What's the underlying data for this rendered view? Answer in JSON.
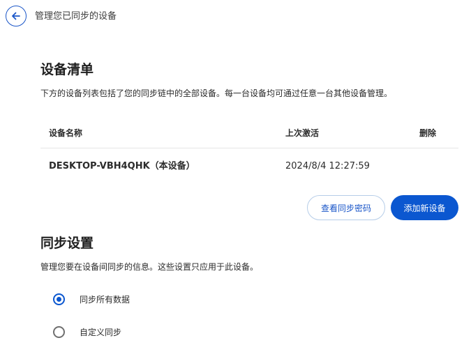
{
  "header": {
    "title": "管理您已同步的设备"
  },
  "devices_section": {
    "title": "设备清单",
    "description": "下方的设备列表包括了您的同步链中的全部设备。每一台设备均可通过任意一台其他设备管理。",
    "table": {
      "columns": [
        "设备名称",
        "上次激活",
        "删除"
      ],
      "rows": [
        {
          "name": "DESKTOP-VBH4QHK（本设备）",
          "last_active": "2024/8/4 12:27:59"
        }
      ]
    },
    "buttons": {
      "view_code": "查看同步密码",
      "add_device": "添加新设备"
    }
  },
  "sync_section": {
    "title": "同步设置",
    "description": "管理您要在设备间同步的信息。这些设置只应用于此设备。",
    "options": [
      {
        "label": "同步所有数据",
        "selected": true
      },
      {
        "label": "自定义同步",
        "selected": false
      }
    ]
  },
  "colors": {
    "accent": "#0b57d0",
    "outline_border": "#b6cde8"
  },
  "icons": {
    "back": "arrow-left-icon"
  }
}
